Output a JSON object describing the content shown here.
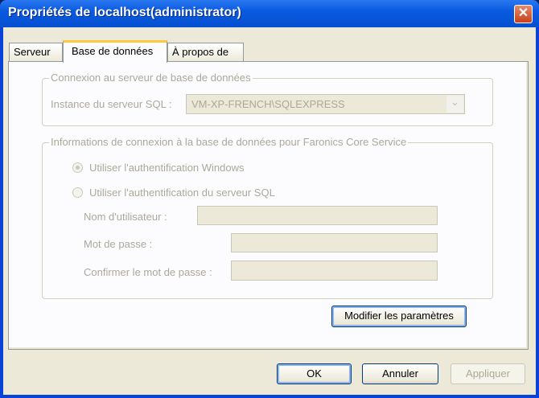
{
  "window": {
    "title": "Propriétés de localhost(administrator)",
    "close_label": "✕"
  },
  "tabs": [
    {
      "label": "Serveur"
    },
    {
      "label": "Base de données"
    },
    {
      "label": "À propos de"
    }
  ],
  "db_group": {
    "legend": "Connexion au serveur de base de données",
    "instance_label": "Instance du serveur SQL :",
    "instance_value": "VM-XP-FRENCH\\SQLEXPRESS",
    "dropdown_glyph": "⌄"
  },
  "auth_group": {
    "legend": "Informations de connexion à la base de données pour Faronics Core Service",
    "radio_windows": "Utiliser l'authentification Windows",
    "radio_sql": "Utiliser l'authentification du serveur SQL",
    "username_label": "Nom d'utilisateur :",
    "username_value": "",
    "password_label": "Mot de passe :",
    "password_value": "",
    "confirm_label": "Confirmer le mot de passe :",
    "confirm_value": ""
  },
  "modify_button": "Modifier les paramètres",
  "buttons": {
    "ok": "OK",
    "cancel": "Annuler",
    "apply": "Appliquer"
  }
}
